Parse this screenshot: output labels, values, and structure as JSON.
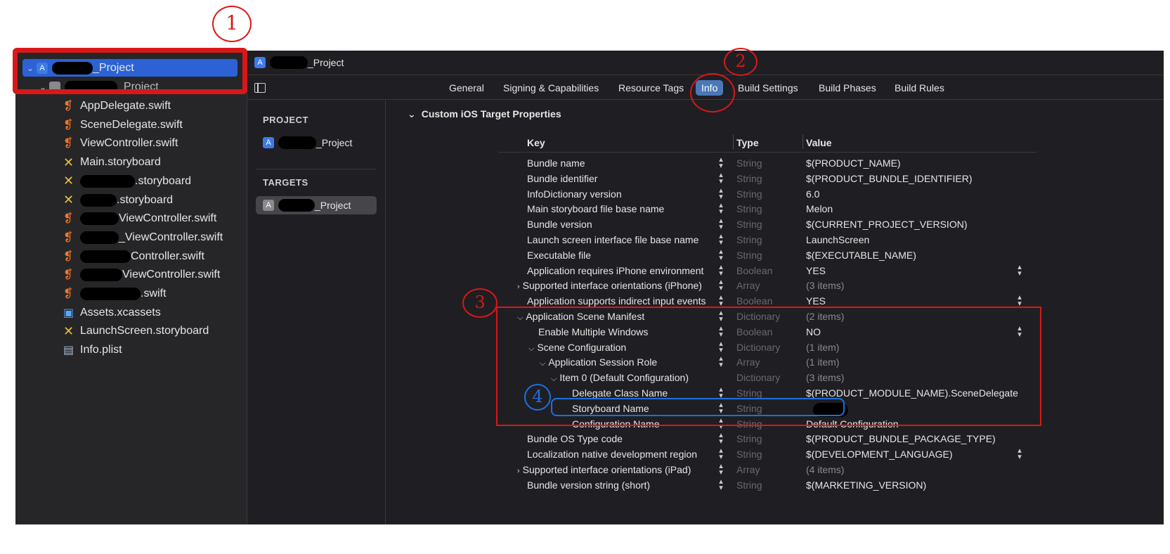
{
  "navigator": {
    "root": "_Project",
    "group": "_Project",
    "files": [
      {
        "icon": "swift-file-icon",
        "name": "AppDelegate.swift",
        "redact": 0
      },
      {
        "icon": "swift-file-icon",
        "name": "SceneDelegate.swift",
        "redact": 0
      },
      {
        "icon": "swift-file-icon",
        "name": "ViewController.swift",
        "redact": 0
      },
      {
        "icon": "storyboard-file-icon",
        "name": "Main.storyboard",
        "redact": 0
      },
      {
        "icon": "storyboard-file-icon",
        "name": ".storyboard",
        "redact": 78
      },
      {
        "icon": "storyboard-file-icon",
        "name": ".storyboard",
        "redact": 52
      },
      {
        "icon": "swift-file-icon",
        "name": "ViewController.swift",
        "redact": 55
      },
      {
        "icon": "swift-file-icon",
        "name": "_ViewController.swift",
        "redact": 55
      },
      {
        "icon": "swift-file-icon",
        "name": "Controller.swift",
        "redact": 72
      },
      {
        "icon": "swift-file-icon",
        "name": "ViewController.swift",
        "redact": 60
      },
      {
        "icon": "swift-file-icon",
        "name": ".swift",
        "redact": 86
      },
      {
        "icon": "assets-icon",
        "name": "Assets.xcassets",
        "redact": 0
      },
      {
        "icon": "storyboard-file-icon",
        "name": "LaunchScreen.storyboard",
        "redact": 0
      },
      {
        "icon": "plist-icon",
        "name": "Info.plist",
        "redact": 0
      }
    ]
  },
  "editor": {
    "breadcrumb": "_Project",
    "tabs": [
      "General",
      "Signing & Capabilities",
      "Resource Tags",
      "Info",
      "Build Settings",
      "Build Phases",
      "Build Rules"
    ],
    "active_tab": "Info",
    "project_header": "PROJECT",
    "project_item": "_Project",
    "targets_header": "TARGETS",
    "target_item": "_Project",
    "section_title": "Custom iOS Target Properties",
    "columns": {
      "key": "Key",
      "type": "Type",
      "value": "Value"
    },
    "rows": [
      {
        "key": "Bundle name",
        "indent": 0,
        "tri": "",
        "type": "String",
        "value": "$(PRODUCT_NAME)",
        "popup": false,
        "dim": false
      },
      {
        "key": "Bundle identifier",
        "indent": 0,
        "tri": "",
        "type": "String",
        "value": "$(PRODUCT_BUNDLE_IDENTIFIER)",
        "popup": false,
        "dim": false
      },
      {
        "key": "InfoDictionary version",
        "indent": 0,
        "tri": "",
        "type": "String",
        "value": "6.0",
        "popup": false,
        "dim": false
      },
      {
        "key": "Main storyboard file base name",
        "indent": 0,
        "tri": "",
        "type": "String",
        "value": "Melon",
        "popup": false,
        "dim": false
      },
      {
        "key": "Bundle version",
        "indent": 0,
        "tri": "",
        "type": "String",
        "value": "$(CURRENT_PROJECT_VERSION)",
        "popup": false,
        "dim": false
      },
      {
        "key": "Launch screen interface file base name",
        "indent": 0,
        "tri": "",
        "type": "String",
        "value": "LaunchScreen",
        "popup": false,
        "dim": false
      },
      {
        "key": "Executable file",
        "indent": 0,
        "tri": "",
        "type": "String",
        "value": "$(EXECUTABLE_NAME)",
        "popup": false,
        "dim": false
      },
      {
        "key": "Application requires iPhone environment",
        "indent": 0,
        "tri": "",
        "type": "Boolean",
        "value": "YES",
        "popup": true,
        "dim": false
      },
      {
        "key": "Supported interface orientations (iPhone)",
        "indent": 0,
        "tri": ">",
        "type": "Array",
        "value": "(3 items)",
        "popup": false,
        "dim": true
      },
      {
        "key": "Application supports indirect input events",
        "indent": 0,
        "tri": "",
        "type": "Boolean",
        "value": "YES",
        "popup": true,
        "dim": false
      },
      {
        "key": "Application Scene Manifest",
        "indent": 0,
        "tri": "v",
        "type": "Dictionary",
        "value": "(2 items)",
        "popup": false,
        "dim": true
      },
      {
        "key": "Enable Multiple Windows",
        "indent": 1,
        "tri": "",
        "type": "Boolean",
        "value": "NO",
        "popup": true,
        "dim": false
      },
      {
        "key": "Scene Configuration",
        "indent": 1,
        "tri": "v",
        "type": "Dictionary",
        "value": "(1 item)",
        "popup": false,
        "dim": true
      },
      {
        "key": "Application Session Role",
        "indent": 2,
        "tri": "v",
        "type": "Array",
        "value": "(1 item)",
        "popup": false,
        "dim": true
      },
      {
        "key": "Item 0 (Default Configuration)",
        "indent": 3,
        "tri": "v",
        "type": "Dictionary",
        "value": "(3 items)",
        "popup": false,
        "dim": true,
        "nostep": true
      },
      {
        "key": "Delegate Class Name",
        "indent": 4,
        "tri": "",
        "type": "String",
        "value": "$(PRODUCT_MODULE_NAME).SceneDelegate",
        "popup": false,
        "dim": false
      },
      {
        "key": "Storyboard Name",
        "indent": 4,
        "tri": "",
        "type": "String",
        "value": "",
        "popup": false,
        "dim": false,
        "redact": true
      },
      {
        "key": "Configuration Name",
        "indent": 4,
        "tri": "",
        "type": "String",
        "value": "Default Configuration",
        "popup": false,
        "dim": false
      },
      {
        "key": "Bundle OS Type code",
        "indent": 0,
        "tri": "",
        "type": "String",
        "value": "$(PRODUCT_BUNDLE_PACKAGE_TYPE)",
        "popup": false,
        "dim": false
      },
      {
        "key": "Localization native development region",
        "indent": 0,
        "tri": "",
        "type": "String",
        "value": "$(DEVELOPMENT_LANGUAGE)",
        "popup": true,
        "dim": false
      },
      {
        "key": "Supported interface orientations (iPad)",
        "indent": 0,
        "tri": ">",
        "type": "Array",
        "value": "(4 items)",
        "popup": false,
        "dim": true
      },
      {
        "key": "Bundle version string (short)",
        "indent": 0,
        "tri": "",
        "type": "String",
        "value": "$(MARKETING_VERSION)",
        "popup": false,
        "dim": false
      }
    ]
  },
  "annotations": {
    "n1": "1",
    "n2": "2",
    "n3": "3",
    "n4": "4",
    "red": "#d81818",
    "blue": "#1f6fe0"
  }
}
